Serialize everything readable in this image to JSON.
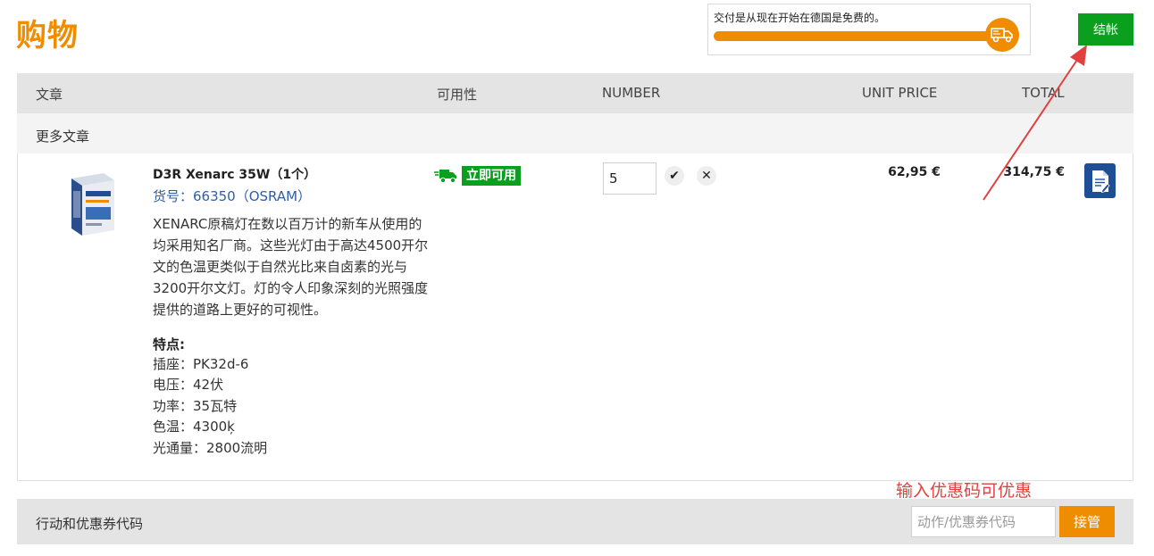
{
  "page": {
    "title": "购物"
  },
  "delivery": {
    "message": "交付是从现在开始在德国是免费的。",
    "icon": "truck-icon",
    "progress": 1.0,
    "color": "#f08c00"
  },
  "checkout": {
    "label": "结帐",
    "color": "#0aa01e"
  },
  "table": {
    "headers": {
      "article": "文章",
      "availability": "可用性",
      "number": "NUMBER",
      "unit_price": "UNIT PRICE",
      "total": "TOTAL"
    },
    "section_title": "更多文章"
  },
  "item": {
    "image_icon": "bulb-box-icon",
    "name": "D3R Xenarc 35W（1个）",
    "sku": "货号：66350（OSRAM）",
    "description": "XENARC原稿灯在数以百万计的新车从使用的均采用知名厂商。这些光灯由于高达4500开尔文的色温更类似于自然光比来自卤素的光与3200开尔文灯。灯的令人印象深刻的光照强度提供的道路上更好的可视性。",
    "features_title": "特点:",
    "features": [
      "插座：PK32d-6",
      "电压：42伏",
      "功率：35瓦特",
      "色温：4300ķ",
      "光通量：2800流明"
    ],
    "availability": "立即可用",
    "availability_icon": "truck-icon",
    "quantity": "5",
    "unit_price": "62,95 €",
    "total": "314,75 €",
    "doc_icon": "document-edit-icon"
  },
  "annotation": {
    "promo_hint": "输入优惠码可优惠",
    "color": "#e04040"
  },
  "promo": {
    "label": "行动和优惠券代码",
    "placeholder": "动作/优惠券代码",
    "apply_label": "接管"
  }
}
